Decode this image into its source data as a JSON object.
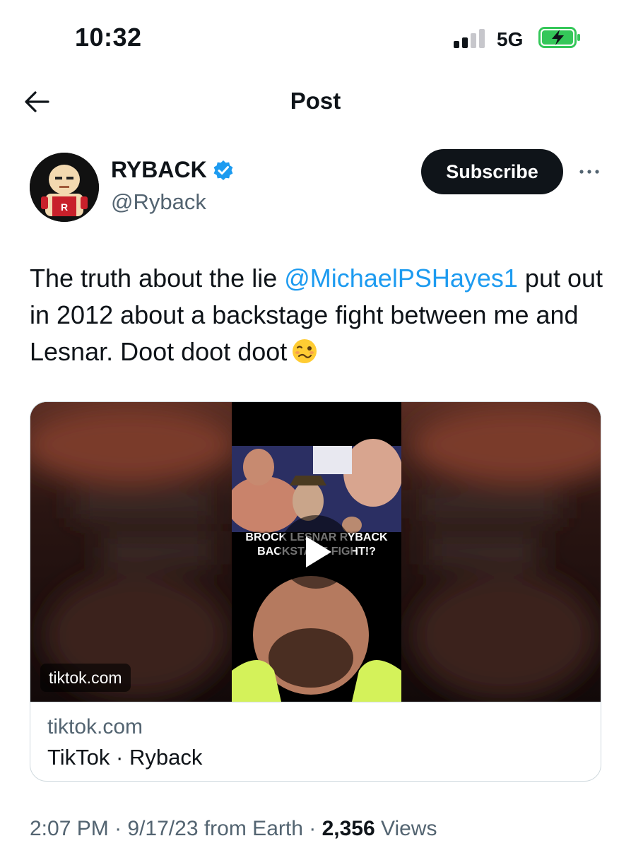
{
  "status_bar": {
    "time": "10:32",
    "network": "5G",
    "icons": [
      "signal-icon",
      "battery-charging-icon"
    ]
  },
  "nav": {
    "title": "Post",
    "back_icon": "arrow-left-icon"
  },
  "author": {
    "display_name": "RYBACK",
    "handle": "@Ryback",
    "verified": true,
    "subscribe_label": "Subscribe",
    "more_icon": "more-horizontal-icon"
  },
  "tweet": {
    "text_before": "The truth about the lie ",
    "mention": "@MichaelPSHayes1",
    "text_after": " put out in 2012 about a backstage fight between me and Lesnar. Doot doot doot",
    "emoji": "woozy-face"
  },
  "card": {
    "media_domain": "tiktok.com",
    "thumbnail_caption_line1": "BROCK LESNAR RYBACK",
    "thumbnail_caption_line2": "BACKSTAGE FIGHT!?",
    "domain": "tiktok.com",
    "title": "TikTok · Ryback"
  },
  "meta": {
    "time": "2:07 PM",
    "date": "9/17/23",
    "source": "from Earth",
    "views_count": "2,356",
    "views_label": "Views"
  },
  "colors": {
    "link": "#1d9bf0",
    "secondary_text": "#536471",
    "battery_fill": "#34c759",
    "button_bg": "#0f1419"
  }
}
